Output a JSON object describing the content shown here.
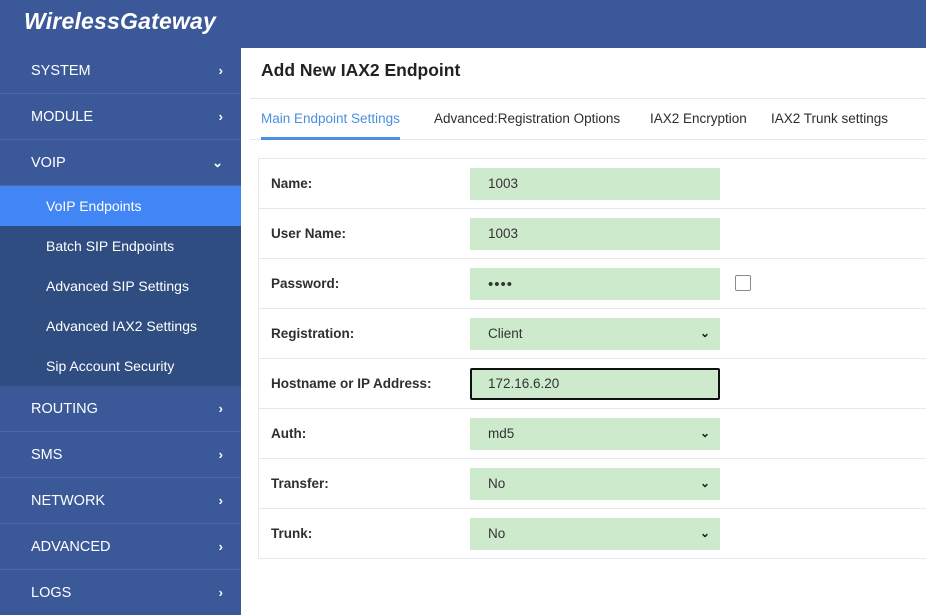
{
  "brand": {
    "name": "WirelessGateway"
  },
  "sidebar": {
    "items": [
      {
        "label": "SYSTEM",
        "chevron": "›",
        "icon": "chevron-right-icon"
      },
      {
        "label": "MODULE",
        "chevron": "›",
        "icon": "chevron-right-icon"
      },
      {
        "label": "VOIP",
        "chevron": "⌄",
        "icon": "chevron-down-icon"
      },
      {
        "label": "ROUTING",
        "chevron": "›",
        "icon": "chevron-right-icon"
      },
      {
        "label": "SMS",
        "chevron": "›",
        "icon": "chevron-right-icon"
      },
      {
        "label": "NETWORK",
        "chevron": "›",
        "icon": "chevron-right-icon"
      },
      {
        "label": "ADVANCED",
        "chevron": "›",
        "icon": "chevron-right-icon"
      },
      {
        "label": "LOGS",
        "chevron": "›",
        "icon": "chevron-right-icon"
      }
    ],
    "voip_subitems": [
      {
        "label": "VoIP Endpoints",
        "active": true
      },
      {
        "label": "Batch SIP Endpoints",
        "active": false
      },
      {
        "label": "Advanced SIP Settings",
        "active": false
      },
      {
        "label": "Advanced IAX2 Settings",
        "active": false
      },
      {
        "label": "Sip Account Security",
        "active": false
      }
    ]
  },
  "main": {
    "title": "Add New IAX2 Endpoint",
    "tabs": [
      {
        "label": "Main Endpoint Settings",
        "active": true
      },
      {
        "label": "Advanced:Registration Options",
        "active": false
      },
      {
        "label": "IAX2 Encryption",
        "active": false
      },
      {
        "label": "IAX2 Trunk settings",
        "active": false
      }
    ],
    "fields": [
      {
        "label": "Name:",
        "type": "text",
        "value": "1003"
      },
      {
        "label": "User Name:",
        "type": "text",
        "value": "1003"
      },
      {
        "label": "Password:",
        "type": "password",
        "value": "••••",
        "show_password_checkbox": true,
        "checked": false
      },
      {
        "label": "Registration:",
        "type": "select",
        "value": "Client",
        "arrow": "⌄"
      },
      {
        "label": "Hostname or IP Address:",
        "type": "text",
        "value": "172.16.6.20",
        "focused": true
      },
      {
        "label": "Auth:",
        "type": "select",
        "value": "md5",
        "arrow": "⌄"
      },
      {
        "label": "Transfer:",
        "type": "select",
        "value": "No",
        "arrow": "⌄"
      },
      {
        "label": "Trunk:",
        "type": "select",
        "value": "No",
        "arrow": "⌄"
      }
    ]
  },
  "colors": {
    "brand_blue": "#3b5998",
    "submenu_blue": "#2f4d80",
    "active_blue": "#4285f4",
    "tab_accent": "#4a90e2",
    "field_green": "#cdeacd"
  }
}
